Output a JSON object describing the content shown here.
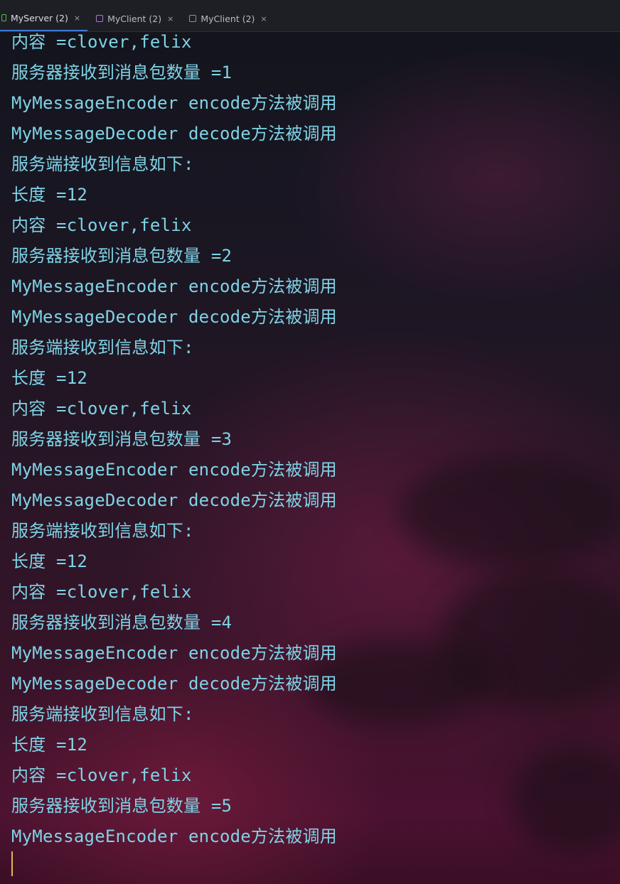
{
  "tabs": [
    {
      "label": "MyServer (2)",
      "close": "×",
      "active": true
    },
    {
      "label": "MyClient (2)",
      "close": "×",
      "active": false
    },
    {
      "label": "MyClient (2)",
      "close": "×",
      "active": false
    }
  ],
  "console": {
    "lines": [
      "内容 =clover,felix",
      "服务器接收到消息包数量 =1",
      "MyMessageEncoder encode方法被调用",
      "MyMessageDecoder decode方法被调用",
      "服务端接收到信息如下:",
      "长度 =12",
      "内容 =clover,felix",
      "服务器接收到消息包数量 =2",
      "MyMessageEncoder encode方法被调用",
      "MyMessageDecoder decode方法被调用",
      "服务端接收到信息如下:",
      "长度 =12",
      "内容 =clover,felix",
      "服务器接收到消息包数量 =3",
      "MyMessageEncoder encode方法被调用",
      "MyMessageDecoder decode方法被调用",
      "服务端接收到信息如下:",
      "长度 =12",
      "内容 =clover,felix",
      "服务器接收到消息包数量 =4",
      "MyMessageEncoder encode方法被调用",
      "MyMessageDecoder decode方法被调用",
      "服务端接收到信息如下:",
      "长度 =12",
      "内容 =clover,felix",
      "服务器接收到消息包数量 =5",
      "MyMessageEncoder encode方法被调用"
    ]
  },
  "colors": {
    "console_text": "#7fd3e6",
    "caret": "#e5b64a",
    "tab_active_underline": "#3d7bd9"
  }
}
